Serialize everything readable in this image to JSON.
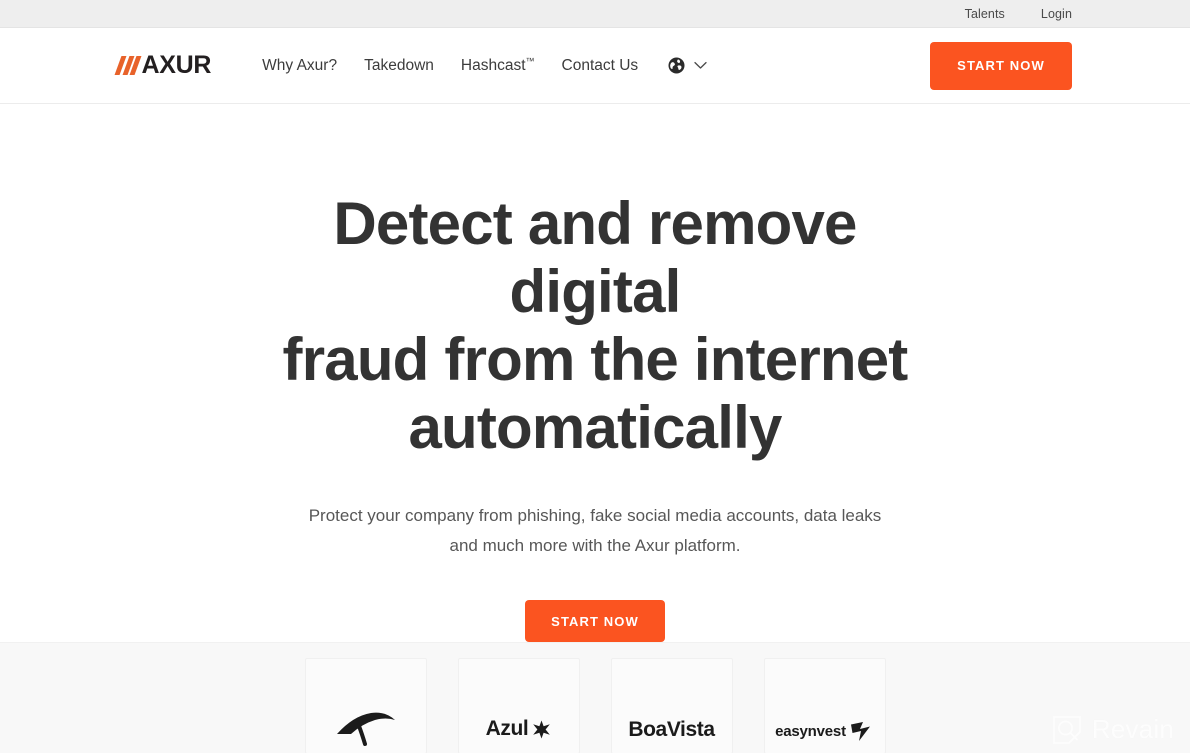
{
  "topbar": {
    "links": [
      {
        "label": "Talents"
      },
      {
        "label": "Login"
      }
    ]
  },
  "header": {
    "logo": {
      "text": "AXUR",
      "mark": "slashes-icon",
      "accent_color": "#e8622a"
    },
    "nav": [
      {
        "label": "Why Axur?"
      },
      {
        "label": "Takedown"
      },
      {
        "label": "Hashcast",
        "suffix": "™"
      },
      {
        "label": "Contact Us"
      }
    ],
    "language_selector": {
      "icon": "globe-icon",
      "chevron": "chevron-down-icon"
    },
    "cta_label": "START NOW",
    "cta_color": "#fb5420"
  },
  "hero": {
    "title_line_1": "Detect and remove digital",
    "title_line_2": "fraud from the internet",
    "title_line_3": "automatically",
    "subtitle": "Protect your company from phishing, fake social media accounts, data leaks and much more with the Axur platform.",
    "cta_label": "START NOW",
    "title_color": "#333333"
  },
  "logo_strip": {
    "brands": [
      {
        "name": "bird-mark",
        "label": ""
      },
      {
        "name": "azul",
        "label": "Azul"
      },
      {
        "name": "boavista",
        "label": "BoaVista"
      },
      {
        "name": "easynvest",
        "label": "easynvest"
      }
    ]
  },
  "watermark": {
    "label": "Revain",
    "icon": "revain-logo-icon"
  }
}
